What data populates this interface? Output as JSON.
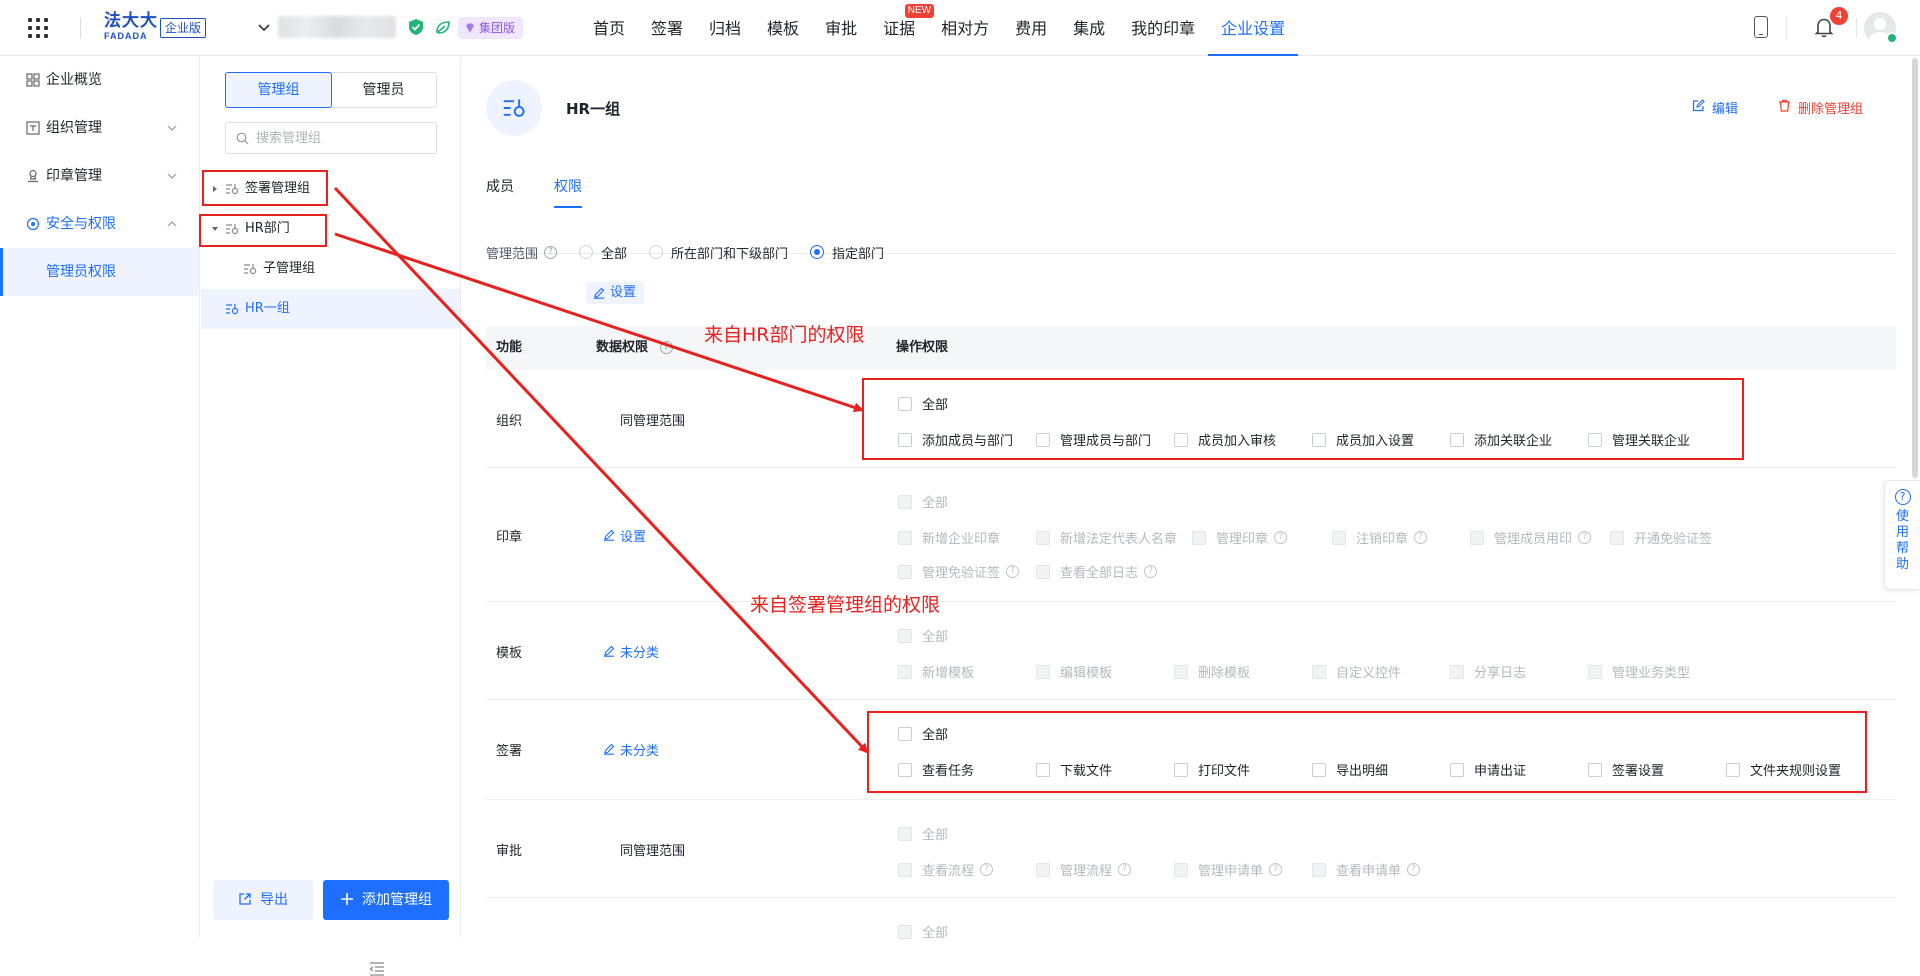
{
  "topbar": {
    "logo_text": "法大大",
    "logo_sub": "FADADA",
    "edition": "企业版",
    "group_tag": "集团版",
    "nav": [
      {
        "label": "首页"
      },
      {
        "label": "签署"
      },
      {
        "label": "归档"
      },
      {
        "label": "模板"
      },
      {
        "label": "审批"
      },
      {
        "label": "证据",
        "badge": "NEW"
      },
      {
        "label": "相对方"
      },
      {
        "label": "费用"
      },
      {
        "label": "集成"
      },
      {
        "label": "我的印章"
      },
      {
        "label": "企业设置",
        "active": true
      }
    ],
    "notification_count": "4",
    "accent_color": "#1e6fff"
  },
  "sidebar": {
    "items": [
      {
        "label": "企业概览",
        "icon": "overview-icon"
      },
      {
        "label": "组织管理",
        "icon": "org-icon"
      },
      {
        "label": "印章管理",
        "icon": "seal-icon"
      },
      {
        "label": "安全与权限",
        "icon": "security-icon"
      }
    ],
    "sub_active": "管理员权限"
  },
  "group_panel": {
    "segments": [
      "管理组",
      "管理员"
    ],
    "search_placeholder": "搜索管理组",
    "tree": [
      {
        "label": "签署管理组"
      },
      {
        "label": "HR部门"
      },
      {
        "label": "子管理组"
      },
      {
        "label": "HR一组"
      }
    ],
    "export_label": "导出",
    "add_label": "添加管理组"
  },
  "main": {
    "title": "HR一组",
    "edit_label": "编辑",
    "delete_label": "删除管理组",
    "tabs": [
      "成员",
      "权限"
    ],
    "scope_label": "管理范围",
    "scope_options": [
      "全部",
      "所在部门和下级部门",
      "指定部门"
    ],
    "scope_selected": "指定部门",
    "scope_set_label": "设置",
    "table_headers": {
      "func": "功能",
      "data": "数据权限",
      "ops": "操作权限"
    },
    "rows": [
      {
        "name": "组织",
        "data": "同管理范围",
        "all": "全部",
        "perms": [
          "添加成员与部门",
          "管理成员与部门",
          "成员加入审核",
          "成员加入设置",
          "添加关联企业",
          "管理关联企业"
        ]
      },
      {
        "name": "印章",
        "data": "设置",
        "all": "全部",
        "perms": [
          "新增企业印章",
          "新增法定代表人名章",
          "管理印章",
          "注销印章",
          "管理成员用印",
          "开通免验证签",
          "管理免验证签",
          "查看全部日志"
        ]
      },
      {
        "name": "模板",
        "data": "未分类",
        "all": "全部",
        "perms": [
          "新增模板",
          "编辑模板",
          "删除模板",
          "自定义控件",
          "分享日志",
          "管理业务类型"
        ]
      },
      {
        "name": "签署",
        "data": "未分类",
        "all": "全部",
        "perms": [
          "查看任务",
          "下载文件",
          "打印文件",
          "导出明细",
          "申请出证",
          "签署设置",
          "文件夹规则设置"
        ]
      },
      {
        "name": "审批",
        "data": "同管理范围",
        "all": "全部",
        "perms": [
          "查看流程",
          "管理流程",
          "管理申请单",
          "查看申请单"
        ]
      }
    ],
    "partial_row_all": "全部"
  },
  "annotations": {
    "from_hr": "来自HR部门的权限",
    "from_sign": "来自签署管理组的权限",
    "color": "#e8211e"
  },
  "help_float": "使用帮助"
}
